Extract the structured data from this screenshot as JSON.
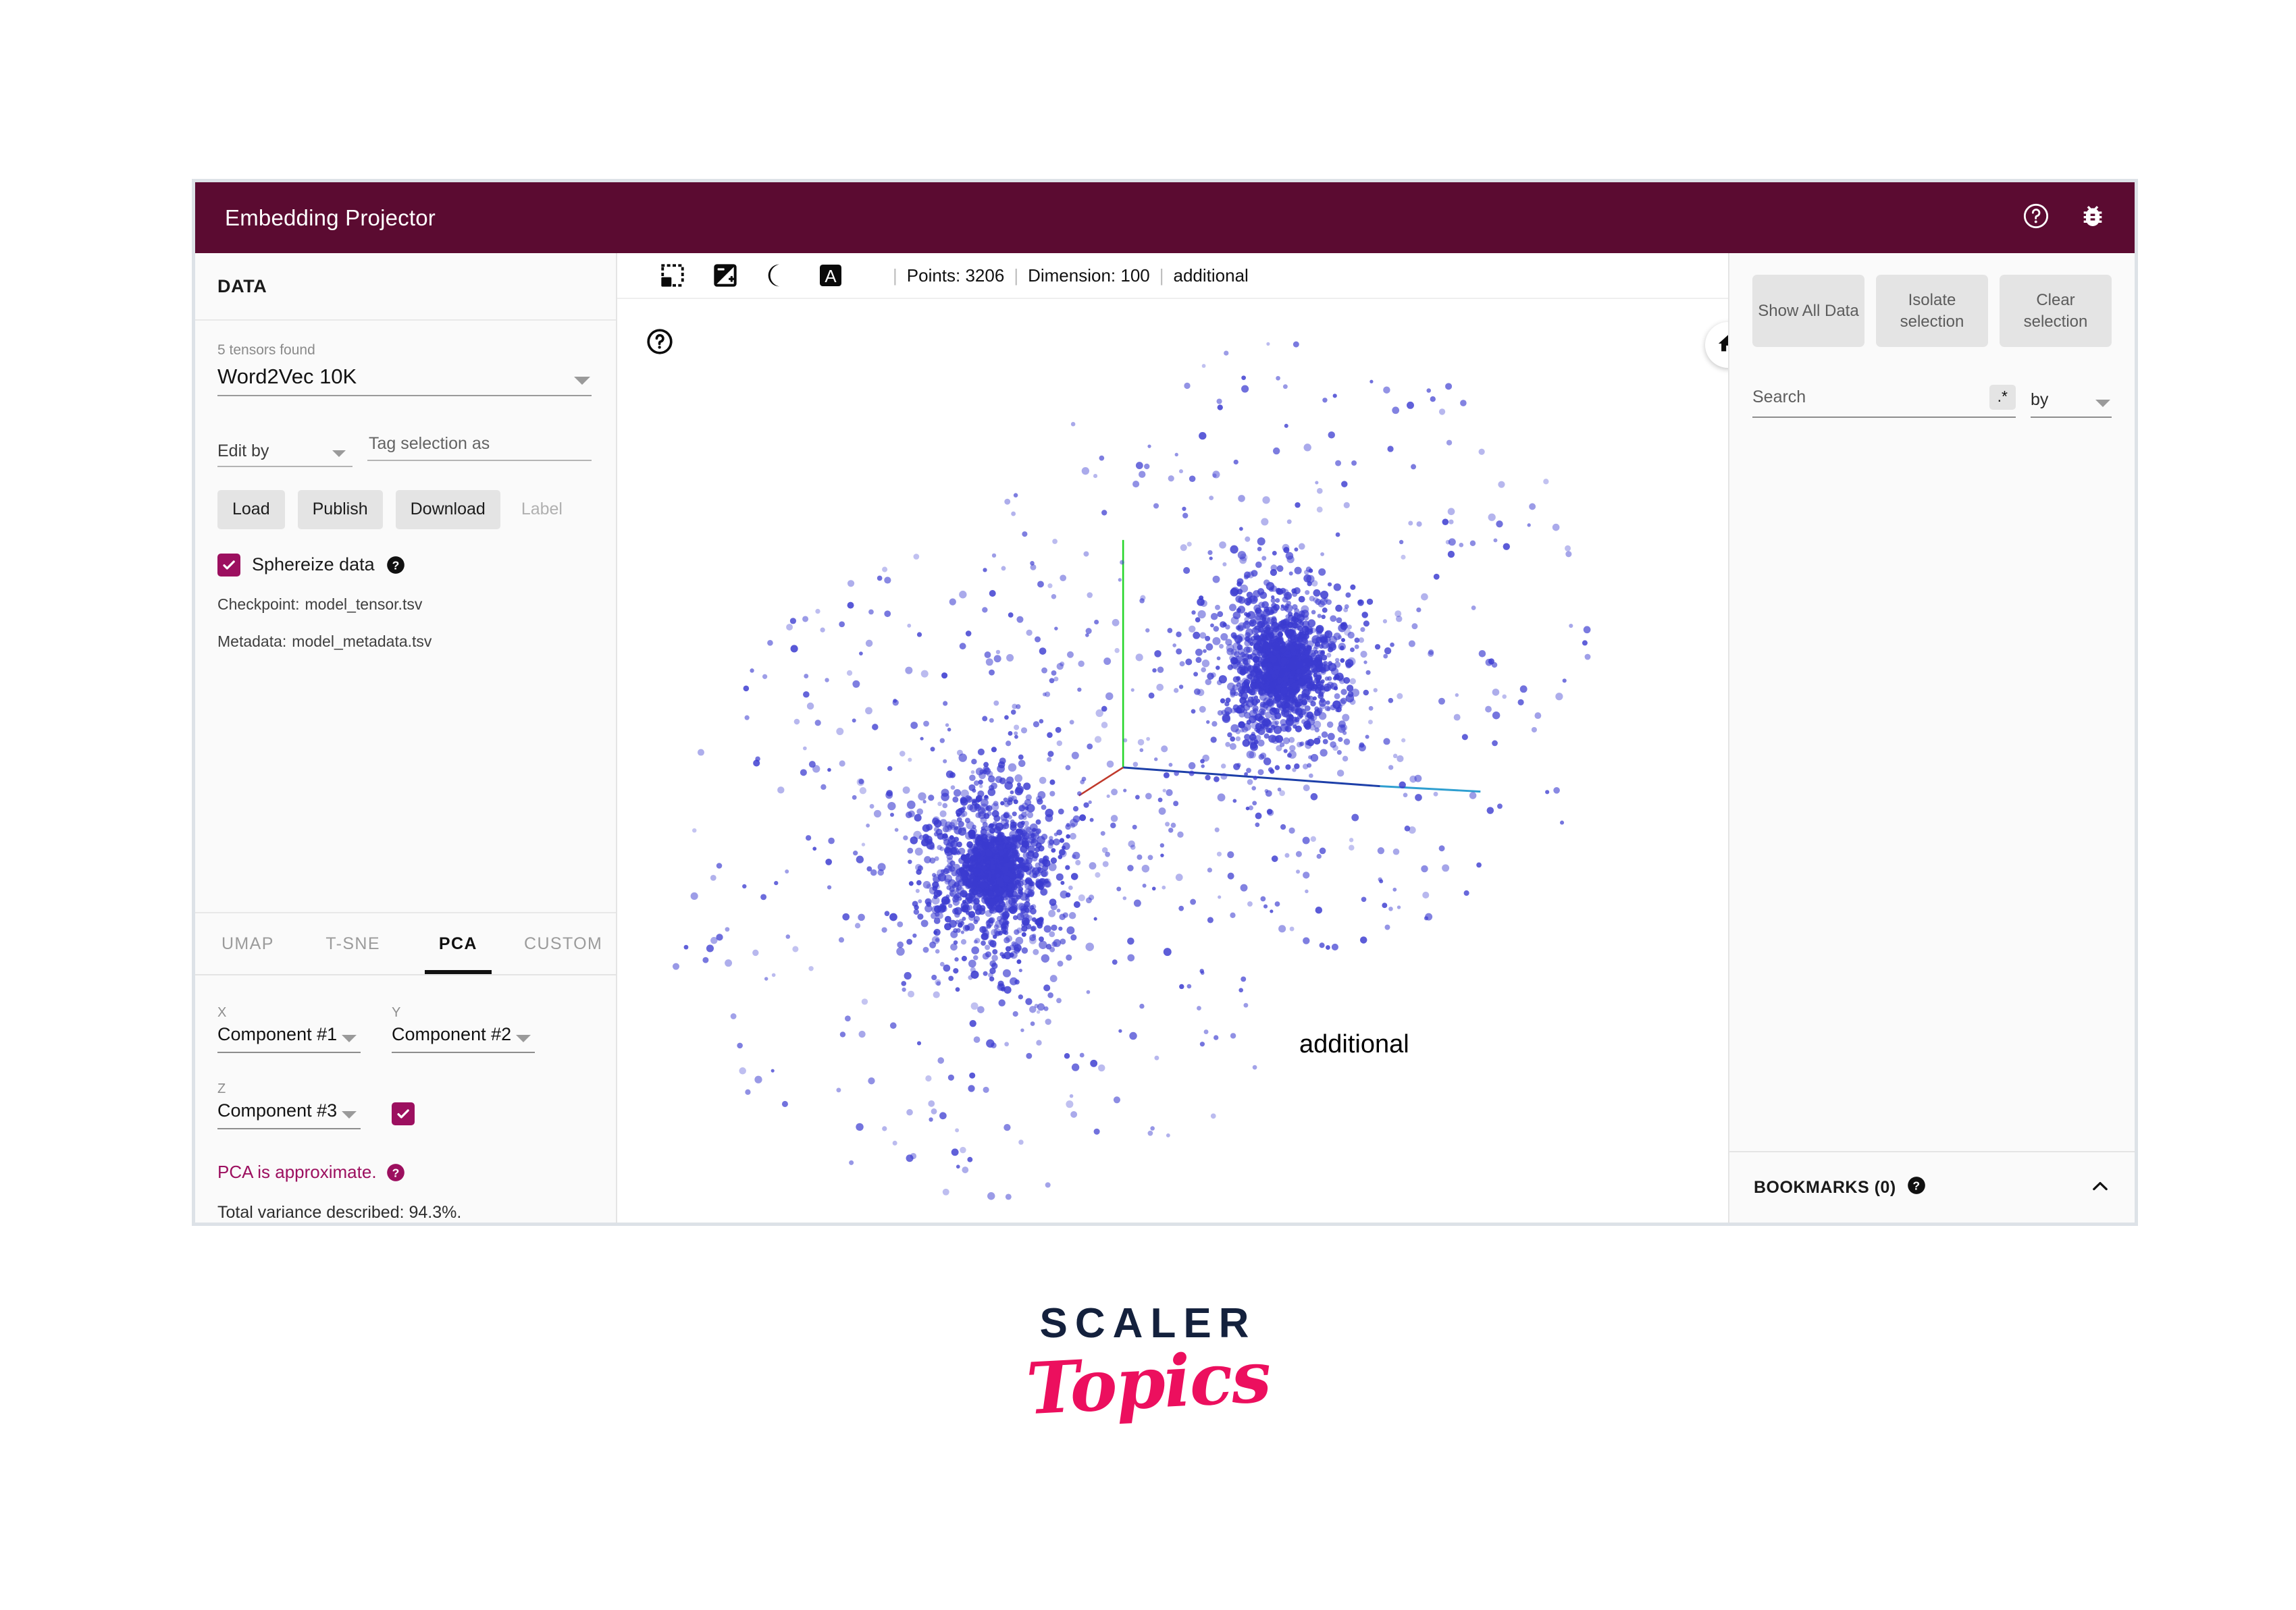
{
  "header": {
    "title": "Embedding Projector",
    "icons": [
      {
        "name": "help-icon",
        "glyph": "?"
      },
      {
        "name": "bug-report-icon",
        "glyph": "bug"
      }
    ]
  },
  "sidebar": {
    "section_title": "DATA",
    "tensor_caption": "5 tensors found",
    "tensor_value": "Word2Vec 10K",
    "edit_by_label": "Edit by",
    "tag_placeholder": "Tag selection as",
    "tag_value": "",
    "buttons": {
      "load": "Load",
      "publish": "Publish",
      "download": "Download",
      "label": "Label"
    },
    "sphereize_label": "Sphereize data",
    "sphereize_checked": true,
    "checkpoint_key": "Checkpoint:",
    "checkpoint_value": "model_tensor.tsv",
    "metadata_key": "Metadata:",
    "metadata_value": "model_metadata.tsv"
  },
  "projection": {
    "tabs": [
      {
        "label": "UMAP",
        "active": false
      },
      {
        "label": "T-SNE",
        "active": false
      },
      {
        "label": "PCA",
        "active": true
      },
      {
        "label": "CUSTOM",
        "active": false
      }
    ],
    "x_label": "X",
    "x_value": "Component #1",
    "y_label": "Y",
    "y_value": "Component #2",
    "z_label": "Z",
    "z_value": "Component #3",
    "z_enabled": true,
    "approx_note": "PCA is approximate.",
    "variance_text": "Total variance described: 94.3%."
  },
  "canvas": {
    "toolbar_icons": [
      {
        "name": "select-box-icon"
      },
      {
        "name": "night-mode-contrast-icon"
      },
      {
        "name": "moon-icon"
      },
      {
        "name": "labels-icon"
      }
    ],
    "points_label": "Points: 3206",
    "dimension_label": "Dimension: 100",
    "selected_label": "additional",
    "sep": "|",
    "home_icon": "home-icon",
    "help_icon": "help-icon",
    "hovered_point_label": "additional"
  },
  "inspector": {
    "show_all_data": "Show All Data",
    "isolate_selection": "Isolate selection",
    "clear_selection": "Clear selection",
    "search_placeholder": "Search",
    "search_value": "",
    "regex_toggle": ".*",
    "by_label": "by",
    "bookmarks_title": "BOOKMARKS (0)"
  },
  "branding": {
    "line1": "SCALER",
    "line2": "Topics"
  },
  "colors": {
    "header_maroon": "#5B0B31",
    "accent_magenta": "#9C0F5F",
    "point_blue": "#3b3bd0",
    "axis_y_green": "#27d62a",
    "axis_x_blue": "#1d3fa8",
    "axis_z_red": "#c0392b",
    "logo_navy": "#14213d",
    "logo_pink": "#ec0f5e"
  },
  "chart_data": {
    "type": "scatter",
    "title": "",
    "xlabel": "Component #1",
    "ylabel": "Component #2",
    "zlabel": "Component #3",
    "n_points": 3206,
    "dimension": 100,
    "annotations": [
      "additional"
    ],
    "clusters": [
      {
        "name": "left-cluster",
        "cx": 0.34,
        "cy": 0.62,
        "n": 900,
        "spread": 0.045
      },
      {
        "name": "right-cluster",
        "cx": 0.6,
        "cy": 0.4,
        "n": 950,
        "spread": 0.042
      }
    ],
    "scatter_halo_n": 700,
    "axes_origin": {
      "x": 0.455,
      "y": 0.58
    },
    "grid": false,
    "legend": "none"
  }
}
